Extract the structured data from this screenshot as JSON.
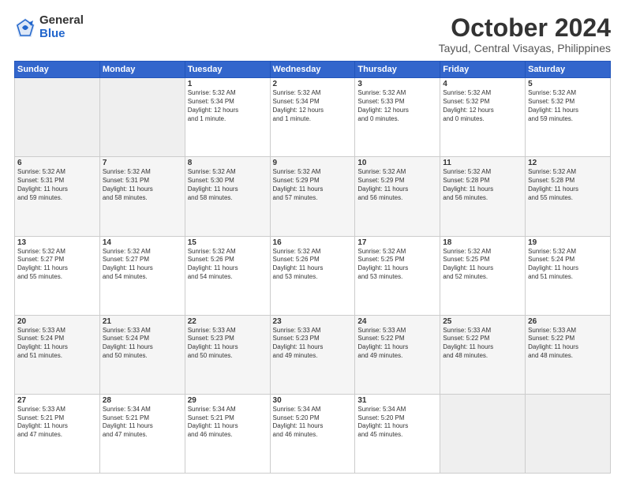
{
  "logo": {
    "general": "General",
    "blue": "Blue"
  },
  "header": {
    "month": "October 2024",
    "location": "Tayud, Central Visayas, Philippines"
  },
  "weekdays": [
    "Sunday",
    "Monday",
    "Tuesday",
    "Wednesday",
    "Thursday",
    "Friday",
    "Saturday"
  ],
  "weeks": [
    [
      {
        "day": "",
        "content": ""
      },
      {
        "day": "",
        "content": ""
      },
      {
        "day": "1",
        "content": "Sunrise: 5:32 AM\nSunset: 5:34 PM\nDaylight: 12 hours\nand 1 minute."
      },
      {
        "day": "2",
        "content": "Sunrise: 5:32 AM\nSunset: 5:34 PM\nDaylight: 12 hours\nand 1 minute."
      },
      {
        "day": "3",
        "content": "Sunrise: 5:32 AM\nSunset: 5:33 PM\nDaylight: 12 hours\nand 0 minutes."
      },
      {
        "day": "4",
        "content": "Sunrise: 5:32 AM\nSunset: 5:32 PM\nDaylight: 12 hours\nand 0 minutes."
      },
      {
        "day": "5",
        "content": "Sunrise: 5:32 AM\nSunset: 5:32 PM\nDaylight: 11 hours\nand 59 minutes."
      }
    ],
    [
      {
        "day": "6",
        "content": "Sunrise: 5:32 AM\nSunset: 5:31 PM\nDaylight: 11 hours\nand 59 minutes."
      },
      {
        "day": "7",
        "content": "Sunrise: 5:32 AM\nSunset: 5:31 PM\nDaylight: 11 hours\nand 58 minutes."
      },
      {
        "day": "8",
        "content": "Sunrise: 5:32 AM\nSunset: 5:30 PM\nDaylight: 11 hours\nand 58 minutes."
      },
      {
        "day": "9",
        "content": "Sunrise: 5:32 AM\nSunset: 5:29 PM\nDaylight: 11 hours\nand 57 minutes."
      },
      {
        "day": "10",
        "content": "Sunrise: 5:32 AM\nSunset: 5:29 PM\nDaylight: 11 hours\nand 56 minutes."
      },
      {
        "day": "11",
        "content": "Sunrise: 5:32 AM\nSunset: 5:28 PM\nDaylight: 11 hours\nand 56 minutes."
      },
      {
        "day": "12",
        "content": "Sunrise: 5:32 AM\nSunset: 5:28 PM\nDaylight: 11 hours\nand 55 minutes."
      }
    ],
    [
      {
        "day": "13",
        "content": "Sunrise: 5:32 AM\nSunset: 5:27 PM\nDaylight: 11 hours\nand 55 minutes."
      },
      {
        "day": "14",
        "content": "Sunrise: 5:32 AM\nSunset: 5:27 PM\nDaylight: 11 hours\nand 54 minutes."
      },
      {
        "day": "15",
        "content": "Sunrise: 5:32 AM\nSunset: 5:26 PM\nDaylight: 11 hours\nand 54 minutes."
      },
      {
        "day": "16",
        "content": "Sunrise: 5:32 AM\nSunset: 5:26 PM\nDaylight: 11 hours\nand 53 minutes."
      },
      {
        "day": "17",
        "content": "Sunrise: 5:32 AM\nSunset: 5:25 PM\nDaylight: 11 hours\nand 53 minutes."
      },
      {
        "day": "18",
        "content": "Sunrise: 5:32 AM\nSunset: 5:25 PM\nDaylight: 11 hours\nand 52 minutes."
      },
      {
        "day": "19",
        "content": "Sunrise: 5:32 AM\nSunset: 5:24 PM\nDaylight: 11 hours\nand 51 minutes."
      }
    ],
    [
      {
        "day": "20",
        "content": "Sunrise: 5:33 AM\nSunset: 5:24 PM\nDaylight: 11 hours\nand 51 minutes."
      },
      {
        "day": "21",
        "content": "Sunrise: 5:33 AM\nSunset: 5:24 PM\nDaylight: 11 hours\nand 50 minutes."
      },
      {
        "day": "22",
        "content": "Sunrise: 5:33 AM\nSunset: 5:23 PM\nDaylight: 11 hours\nand 50 minutes."
      },
      {
        "day": "23",
        "content": "Sunrise: 5:33 AM\nSunset: 5:23 PM\nDaylight: 11 hours\nand 49 minutes."
      },
      {
        "day": "24",
        "content": "Sunrise: 5:33 AM\nSunset: 5:22 PM\nDaylight: 11 hours\nand 49 minutes."
      },
      {
        "day": "25",
        "content": "Sunrise: 5:33 AM\nSunset: 5:22 PM\nDaylight: 11 hours\nand 48 minutes."
      },
      {
        "day": "26",
        "content": "Sunrise: 5:33 AM\nSunset: 5:22 PM\nDaylight: 11 hours\nand 48 minutes."
      }
    ],
    [
      {
        "day": "27",
        "content": "Sunrise: 5:33 AM\nSunset: 5:21 PM\nDaylight: 11 hours\nand 47 minutes."
      },
      {
        "day": "28",
        "content": "Sunrise: 5:34 AM\nSunset: 5:21 PM\nDaylight: 11 hours\nand 47 minutes."
      },
      {
        "day": "29",
        "content": "Sunrise: 5:34 AM\nSunset: 5:21 PM\nDaylight: 11 hours\nand 46 minutes."
      },
      {
        "day": "30",
        "content": "Sunrise: 5:34 AM\nSunset: 5:20 PM\nDaylight: 11 hours\nand 46 minutes."
      },
      {
        "day": "31",
        "content": "Sunrise: 5:34 AM\nSunset: 5:20 PM\nDaylight: 11 hours\nand 45 minutes."
      },
      {
        "day": "",
        "content": ""
      },
      {
        "day": "",
        "content": ""
      }
    ]
  ]
}
